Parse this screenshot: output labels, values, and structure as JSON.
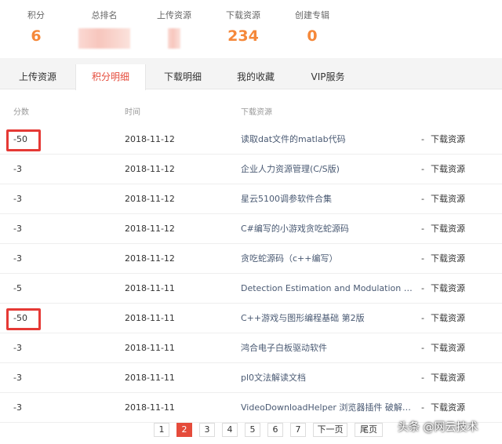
{
  "stats": [
    {
      "label": "积分",
      "value": "6"
    },
    {
      "label": "总排名",
      "value": ""
    },
    {
      "label": "上传资源",
      "value": ""
    },
    {
      "label": "下载资源",
      "value": "234"
    },
    {
      "label": "创建专辑",
      "value": "0"
    }
  ],
  "tabs": [
    {
      "label": "上传资源",
      "active": false
    },
    {
      "label": "积分明细",
      "active": true
    },
    {
      "label": "下载明细",
      "active": false
    },
    {
      "label": "我的收藏",
      "active": false
    },
    {
      "label": "VIP服务",
      "active": false
    }
  ],
  "table": {
    "headers": {
      "score": "分数",
      "time": "时间",
      "resource": "下载资源"
    },
    "rows": [
      {
        "score": "-50",
        "time": "2018-11-12",
        "resource": "读取dat文件的matlab代码",
        "dash": "-",
        "action": "下载资源",
        "highlighted": true
      },
      {
        "score": "-3",
        "time": "2018-11-12",
        "resource": "企业人力资源管理(C/S版)",
        "dash": "-",
        "action": "下载资源",
        "highlighted": false
      },
      {
        "score": "-3",
        "time": "2018-11-12",
        "resource": "星云5100调参软件合集",
        "dash": "-",
        "action": "下载资源",
        "highlighted": false
      },
      {
        "score": "-3",
        "time": "2018-11-12",
        "resource": "C#编写的小游戏贪吃蛇源码",
        "dash": "-",
        "action": "下载资源",
        "highlighted": false
      },
      {
        "score": "-3",
        "time": "2018-11-12",
        "resource": "贪吃蛇源码（c++编写）",
        "dash": "-",
        "action": "下载资源",
        "highlighted": false
      },
      {
        "score": "-5",
        "time": "2018-11-11",
        "resource": "Detection Estimation and Modulation The...",
        "dash": "-",
        "action": "下载资源",
        "highlighted": false
      },
      {
        "score": "-50",
        "time": "2018-11-11",
        "resource": "C++游戏与图形编程基础 第2版",
        "dash": "-",
        "action": "下载资源",
        "highlighted": true
      },
      {
        "score": "-3",
        "time": "2018-11-11",
        "resource": "鸿合电子白板驱动软件",
        "dash": "-",
        "action": "下载资源",
        "highlighted": false
      },
      {
        "score": "-3",
        "time": "2018-11-11",
        "resource": "pl0文法解读文档",
        "dash": "-",
        "action": "下载资源",
        "highlighted": false
      },
      {
        "score": "-3",
        "time": "2018-11-11",
        "resource": "VideoDownloadHelper 浏览器插件 破解版无...",
        "dash": "-",
        "action": "下载资源",
        "highlighted": false
      }
    ]
  },
  "pagination": {
    "pages": [
      "1",
      "2",
      "3",
      "4",
      "5",
      "6",
      "7"
    ],
    "current": "2",
    "next": "下一页",
    "last": "尾页"
  },
  "watermark": "头条 @网云技术",
  "colors": {
    "accent": "#e54b3b",
    "stat_value": "#f5883a",
    "highlight_box": "#e53935"
  }
}
